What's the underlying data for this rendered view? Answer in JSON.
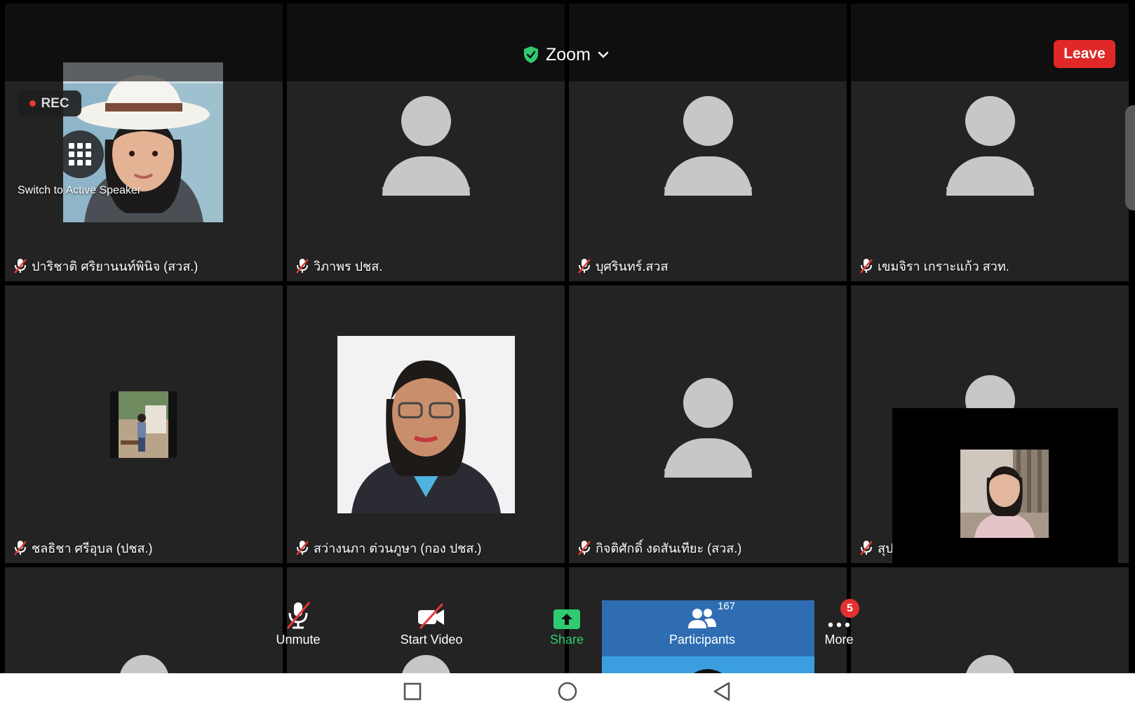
{
  "top_bar": {
    "title": "Zoom",
    "title_icon": "shield-check-icon",
    "dropdown_icon": "chevron-down-icon",
    "leave_label": "Leave",
    "leave_color": "#e02828"
  },
  "recording": {
    "label": "REC",
    "dot_color": "#e53935"
  },
  "switch_view": {
    "label": "Switch to Active Speaker",
    "icon": "grid-icon"
  },
  "participants": [
    {
      "name": "ปาริชาติ ศริยานนท์พินิจ (สวส.)",
      "mic": "muted",
      "display": "photo"
    },
    {
      "name": "วิภาพร  ปชส.",
      "mic": "muted",
      "display": "avatar"
    },
    {
      "name": "บุศรินทร์.สวส",
      "mic": "muted",
      "display": "avatar"
    },
    {
      "name": "เขมจิรา  เกราะแก้ว สวท.",
      "mic": "muted",
      "display": "avatar"
    },
    {
      "name": "ชลธิชา ศรีอุบล (ปชส.)",
      "mic": "muted",
      "display": "small-photo"
    },
    {
      "name": "สว่างนภา ต่วนภูษา (กอง ปชส.)",
      "mic": "muted",
      "display": "photo"
    },
    {
      "name": "กิจติศักดิ์ งดสันเทียะ (สวส.)",
      "mic": "muted",
      "display": "avatar"
    },
    {
      "name": "สุป",
      "mic": "muted",
      "display": "avatar"
    }
  ],
  "toolbar": {
    "unmute_label": "Unmute",
    "video_label": "Start Video",
    "share_label": "Share",
    "participants_label": "Participants",
    "participants_count": "167",
    "more_label": "More",
    "more_badge": "5",
    "share_color": "#2ecc71"
  },
  "nav_bar": {
    "buttons": [
      "square-recents-icon",
      "circle-home-icon",
      "triangle-back-icon"
    ]
  }
}
